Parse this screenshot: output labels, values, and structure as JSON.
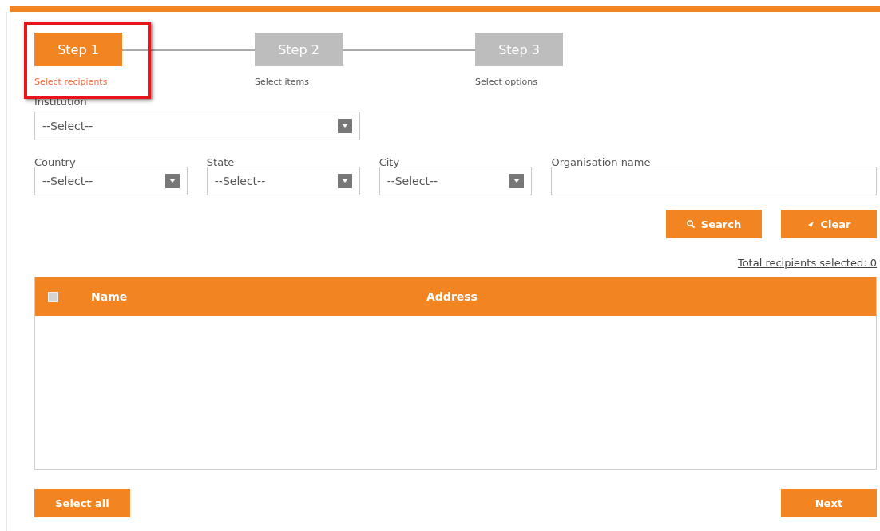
{
  "steps": [
    {
      "label": "Step 1",
      "caption": "Select recipients",
      "selected": true,
      "highlighted": true
    },
    {
      "label": "Step 2",
      "caption": "Select items",
      "selected": false,
      "highlighted": false
    },
    {
      "label": "Step 3",
      "caption": "Select options",
      "selected": false,
      "highlighted": false
    }
  ],
  "institution": {
    "label": "Institution",
    "value": "--Select--"
  },
  "filters": [
    {
      "kind": "select",
      "label": "Country",
      "value": "--Select--"
    },
    {
      "kind": "select",
      "label": "State",
      "value": "--Select--"
    },
    {
      "kind": "select",
      "label": "City",
      "value": "--Select--"
    },
    {
      "kind": "text",
      "label": "Organisation name"
    }
  ],
  "buttons": [
    {
      "kind": "search",
      "label": "Search"
    },
    {
      "kind": "clear",
      "label": "Clear"
    }
  ],
  "total_link": "Total recipients selected: 0",
  "table": {
    "select_all_checked": false,
    "columns": [
      "Name",
      "Address"
    ]
  },
  "footer_buttons": [
    "Select all",
    "Next"
  ]
}
